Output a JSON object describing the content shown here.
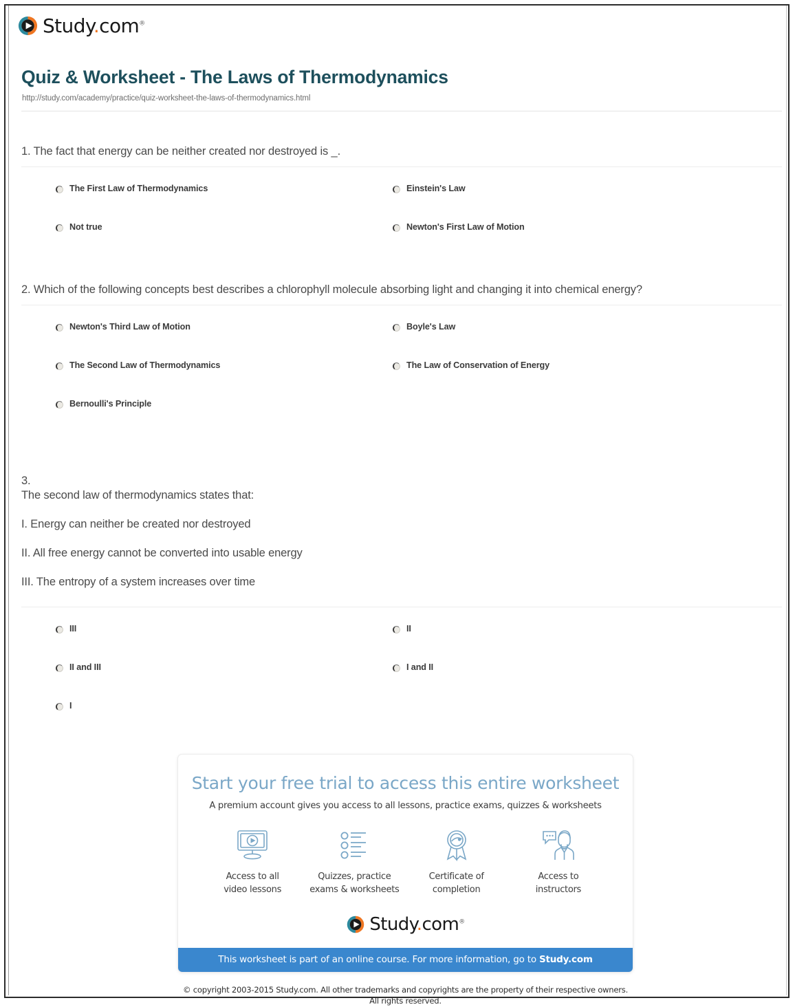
{
  "brand": {
    "name_main": "Study",
    "name_dot": ".",
    "name_tld": "com",
    "trademark": "®",
    "logo_teal": "#2c8a9e",
    "logo_orange": "#ef7622",
    "accent_blue": "#3a87ce",
    "title_color": "#1d4f5c"
  },
  "header": {
    "title": "Quiz & Worksheet - The Laws of Thermodynamics",
    "url": "http://study.com/academy/practice/quiz-worksheet-the-laws-of-thermodynamics.html"
  },
  "questions": [
    {
      "number": "1.",
      "text": "1. The fact that energy can be neither created nor destroyed is _.",
      "options_left": [
        "The First Law of Thermodynamics",
        "Not true"
      ],
      "options_right": [
        "Einstein's Law",
        "Newton's First Law of Motion"
      ]
    },
    {
      "number": "2.",
      "text": "2. Which of the following concepts best describes a chlorophyll molecule absorbing light and changing it into chemical energy?",
      "options_left": [
        "Newton's Third Law of Motion",
        "The Second Law of Thermodynamics",
        "Bernoulli's Principle"
      ],
      "options_right": [
        "Boyle's Law",
        "The Law of Conservation of Energy"
      ]
    },
    {
      "number": "3.",
      "stem_lines": [
        "3.",
        "The second law of thermodynamics states that:",
        "I. Energy can neither be created nor destroyed",
        "II. All free energy cannot be converted into usable energy",
        "III. The entropy of a system increases over time"
      ],
      "options_left": [
        "III",
        "II and III",
        "I"
      ],
      "options_right": [
        "II",
        "I and II"
      ]
    }
  ],
  "promo": {
    "headline": "Start your free trial to access this entire worksheet",
    "subhead": "A premium account gives you access to all lessons, practice exams, quizzes & worksheets",
    "benefits": [
      {
        "icon": "video-monitor-icon",
        "line1": "Access to all",
        "line2": "video lessons"
      },
      {
        "icon": "checklist-icon",
        "line1": "Quizzes, practice",
        "line2": "exams & worksheets"
      },
      {
        "icon": "award-ribbon-icon",
        "line1": "Certificate of",
        "line2": "completion"
      },
      {
        "icon": "instructor-chat-icon",
        "line1": "Access to",
        "line2": "instructors"
      }
    ],
    "bar_text_plain": "This worksheet is part of an online course. For more information, go to ",
    "bar_text_bold": "Study.com"
  },
  "footer": {
    "copyright_line1": "© copyright 2003-2015 Study.com. All other trademarks and copyrights are the property of their respective owners.",
    "copyright_line2": "All rights reserved."
  }
}
